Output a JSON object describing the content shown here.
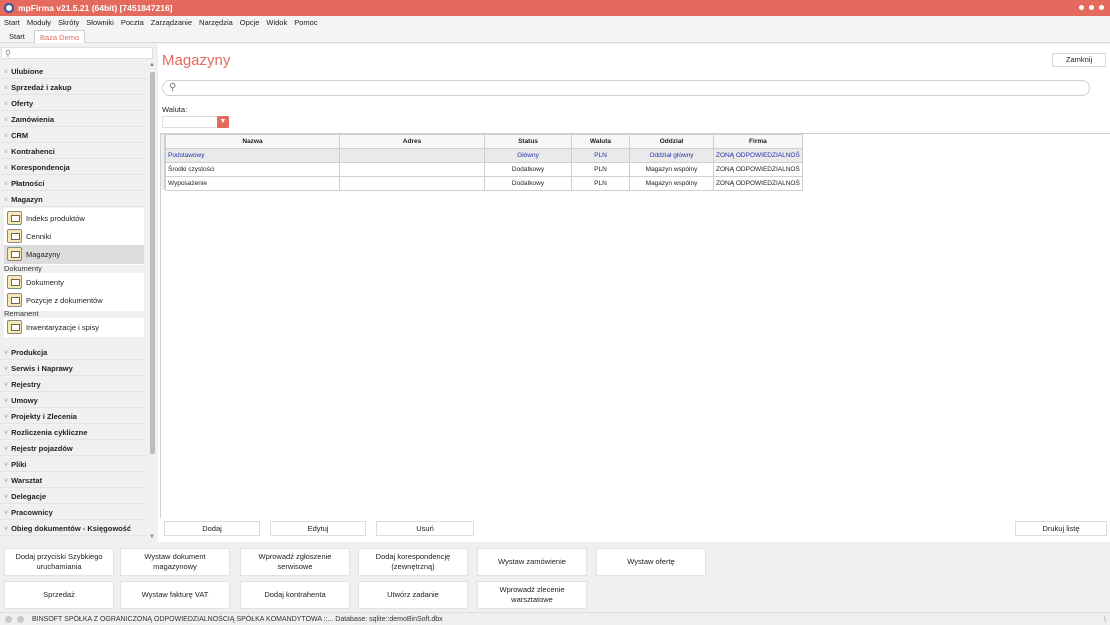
{
  "window": {
    "title": "mpFirma v21.5.21 (64bit) [7451847216]"
  },
  "menu": [
    "Start",
    "Moduły",
    "Skróty",
    "Słowniki",
    "Poczta",
    "Zarządzanie",
    "Narzędzia",
    "Opcje",
    "Widok",
    "Pomoc"
  ],
  "tabs": [
    {
      "label": "Start"
    },
    {
      "label": "Baza Demo"
    }
  ],
  "sidebar": {
    "search_icon": "search-icon",
    "categories_top": [
      "Ulubione",
      "Sprzedaż i zakup",
      "Oferty",
      "Zamówienia",
      "CRM",
      "Kontrahenci",
      "Korespondencja",
      "Płatności",
      "Magazyn"
    ],
    "magazyn_items": [
      "Indeks produktów",
      "Cenniki",
      "Magazyny"
    ],
    "group_dokumenty": "Dokumenty",
    "dokumenty_items": [
      "Dokumenty",
      "Pozycje z dokumentów"
    ],
    "group_remanent": "Remanent",
    "remanent_items": [
      "Inwentaryzacje i spisy"
    ],
    "categories_bottom": [
      "Produkcja",
      "Serwis i Naprawy",
      "Rejestry",
      "Umowy",
      "Projekty i Zlecenia",
      "Rozliczenia cykliczne",
      "Rejestr pojazdów",
      "Pliki",
      "Warsztat",
      "Delegacje",
      "Pracownicy",
      "Obieg dokumentów - Księgowość"
    ]
  },
  "main": {
    "title": "Magazyny",
    "close_label": "Zamknij",
    "currency_label": "Waluta:",
    "table": {
      "columns": [
        "Nazwa",
        "Adres",
        "Status",
        "Waluta",
        "Oddział",
        "Firma"
      ],
      "rows": [
        [
          "Podstawowy",
          "",
          "Główny",
          "PLN",
          "Oddział główny",
          "ZONĄ ODPOWIEDZIALNOŚ"
        ],
        [
          "Środki czystości",
          "",
          "Dodatkowy",
          "PLN",
          "Magazyn wspólny",
          "ZONĄ ODPOWIEDZIALNOŚ"
        ],
        [
          "Wyposażenie",
          "",
          "Dodatkowy",
          "PLN",
          "Magazyn wspólny",
          "ZONĄ ODPOWIEDZIALNOŚ"
        ]
      ]
    },
    "buttons": {
      "add": "Dodaj",
      "edit": "Edytuj",
      "delete": "Usuń",
      "print": "Drukuj listę"
    }
  },
  "quick_actions": {
    "row1": [
      "Dodaj przyciski Szybkiego uruchamiania",
      "Wystaw dokument magazynowy",
      "Wprowadź zgłoszenie serwisowe",
      "Dodaj korespondencję (zewnętrzną)",
      "Wystaw zamówienie",
      "Wystaw ofertę"
    ],
    "row2": [
      "Sprzedaż",
      "Wystaw fakturę VAT",
      "Dodaj kontrahenta",
      "Utwórz zadanie",
      "Wprowadź zlecenie warsztatowe"
    ]
  },
  "status_bar": {
    "text": "BINSOFT SPÓŁKA Z OGRANICZONĄ ODPOWIEDZIALNOŚCIĄ SPÓŁKA KOMANDYTOWA ::... Database: sqlite::demoBinSoft.dbx"
  },
  "colors": {
    "accent": "#e36a5d",
    "selected_text": "#2233aa"
  }
}
